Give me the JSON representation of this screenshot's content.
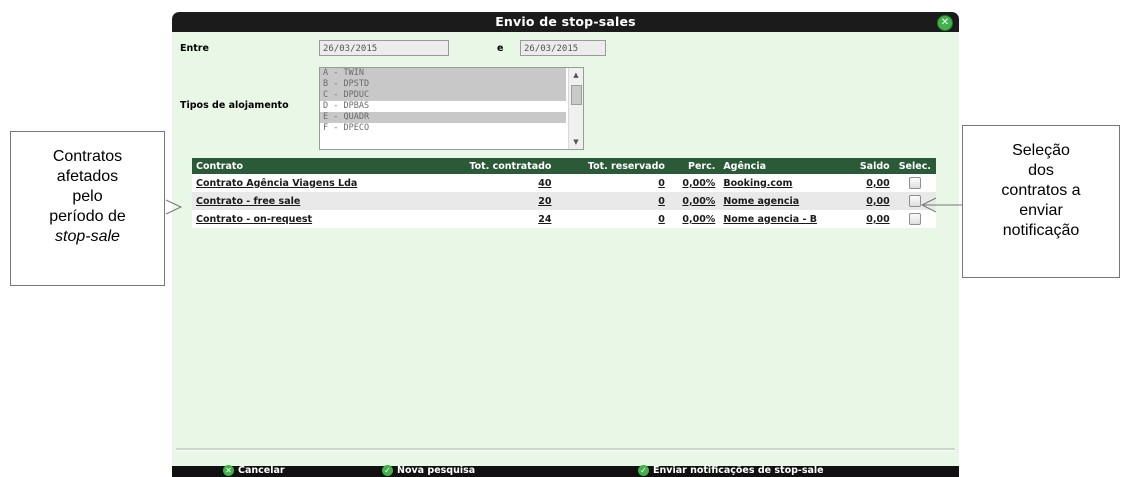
{
  "dialog": {
    "title": "Envio de stop-sales",
    "close_icon": "close-circle-icon"
  },
  "filters": {
    "entre_label": "Entre",
    "date_from": "26/03/2015",
    "e_label": "e",
    "date_to": "26/03/2015",
    "tipos_label": "Tipos de alojamento",
    "tipos_options": [
      {
        "label": "A - TWIN",
        "selected": true
      },
      {
        "label": "B - DPSTD",
        "selected": true
      },
      {
        "label": "C - DPDUC",
        "selected": true
      },
      {
        "label": "D - DPBAS",
        "selected": false
      },
      {
        "label": "E - QUADR",
        "selected": true
      },
      {
        "label": "F - DPECO",
        "selected": false
      }
    ]
  },
  "table": {
    "headers": {
      "contrato": "Contrato",
      "tot_contratado": "Tot. contratado",
      "tot_reservado": "Tot. reservado",
      "perc": "Perc.",
      "agencia": "Agência",
      "saldo": "Saldo",
      "selec": "Selec."
    },
    "rows": [
      {
        "contrato": "Contrato Agência Viagens Lda",
        "tot_contratado": "40",
        "tot_reservado": "0",
        "perc": "0,00%",
        "agencia": "Booking.com",
        "saldo": "0,00",
        "selected": false
      },
      {
        "contrato": "Contrato - free sale",
        "tot_contratado": "20",
        "tot_reservado": "0",
        "perc": "0,00%",
        "agencia": "Nome agencia",
        "saldo": "0,00",
        "selected": false
      },
      {
        "contrato": "Contrato - on-request",
        "tot_contratado": "24",
        "tot_reservado": "0",
        "perc": "0,00%",
        "agencia": "Nome agencia - B",
        "saldo": "0,00",
        "selected": false
      }
    ]
  },
  "footer": {
    "cancel_label": "Cancelar",
    "new_search_label": "Nova pesquisa",
    "send_label": "Enviar notificações de stop-sale"
  },
  "callouts": {
    "left_lines": [
      "Contratos",
      "afetados",
      "pelo",
      "período de"
    ],
    "left_italic": "stop-sale",
    "right_lines": [
      "Seleção",
      "dos",
      "contratos a",
      "enviar",
      "notificação"
    ]
  },
  "colors": {
    "dialog_bg": "#e9f8e6",
    "titlebar": "#1b1b1b",
    "table_header": "#2a5a37",
    "accent_green": "#41b24a"
  }
}
